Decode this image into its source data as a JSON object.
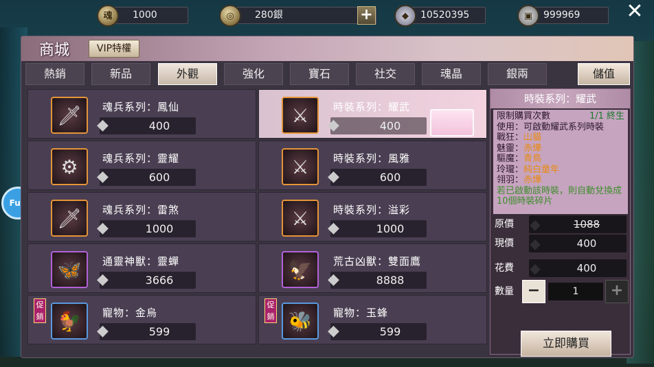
{
  "currencies": [
    {
      "icon": "soul-coin-icon",
      "glyph": "魂",
      "value": "1000"
    },
    {
      "icon": "silver-coin-icon",
      "glyph": "◎",
      "value": "280銀"
    },
    {
      "icon": "diamond-icon",
      "glyph": "◆",
      "value": "10520395"
    },
    {
      "icon": "silver-ingot-icon",
      "glyph": "▣",
      "value": "999969"
    }
  ],
  "header": {
    "title": "商城",
    "vip_label": "VIP特權"
  },
  "tabs": [
    "熱銷",
    "新品",
    "外觀",
    "強化",
    "寶石",
    "社交",
    "魂晶",
    "銀兩"
  ],
  "active_tab": "外觀",
  "store_button": "儲值",
  "side_logo": "Fun",
  "items": [
    {
      "name": "魂兵系列：鳳仙",
      "price": "400",
      "glyph": "🗡",
      "frame": "orange",
      "promo": ""
    },
    {
      "name": "時裝系列：耀武",
      "price": "400",
      "glyph": "⚔",
      "frame": "orange",
      "promo": "",
      "selected": true
    },
    {
      "name": "魂兵系列：靈耀",
      "price": "600",
      "glyph": "⚙",
      "frame": "orange",
      "promo": ""
    },
    {
      "name": "時裝系列：風雅",
      "price": "600",
      "glyph": "⚔",
      "frame": "orange",
      "promo": ""
    },
    {
      "name": "魂兵系列：雷煞",
      "price": "1000",
      "glyph": "🗡",
      "frame": "orange",
      "promo": ""
    },
    {
      "name": "時裝系列：溢彩",
      "price": "1000",
      "glyph": "⚔",
      "frame": "orange",
      "promo": ""
    },
    {
      "name": "通靈神獸：靈蟬",
      "price": "3666",
      "glyph": "🦋",
      "frame": "purple",
      "promo": ""
    },
    {
      "name": "荒古凶獸：雙面鷹",
      "price": "8888",
      "glyph": "🦅",
      "frame": "purple",
      "promo": ""
    },
    {
      "name": "寵物：金烏",
      "price": "599",
      "glyph": "🐓",
      "frame": "blue",
      "promo": "促銷"
    },
    {
      "name": "寵物：玉蜂",
      "price": "599",
      "glyph": "🐝",
      "frame": "blue",
      "promo": "促銷"
    }
  ],
  "detail": {
    "title": "時裝系列：耀武",
    "limit_label": "限制購買次數",
    "limit_count": "1/1 終生",
    "usage": "使用：可啟動耀武系列時裝",
    "stats": [
      {
        "k": "戰狂：",
        "v": "山貓"
      },
      {
        "k": "魅靈：",
        "v": "赤燁"
      },
      {
        "k": "驅魔：",
        "v": "青鳥"
      },
      {
        "k": "玲瓏：",
        "v": "純白童年"
      },
      {
        "k": "翎羽：",
        "v": "赤燁"
      }
    ],
    "note": "若已啟動該時裝，則自動兌換成10個時裝碎片",
    "original_label": "原價",
    "original_price": "1088",
    "current_label": "現價",
    "current_price": "400",
    "cost_label": "花費",
    "cost": "400",
    "qty_label": "數量",
    "qty": "1",
    "buy_label": "立即購買"
  }
}
